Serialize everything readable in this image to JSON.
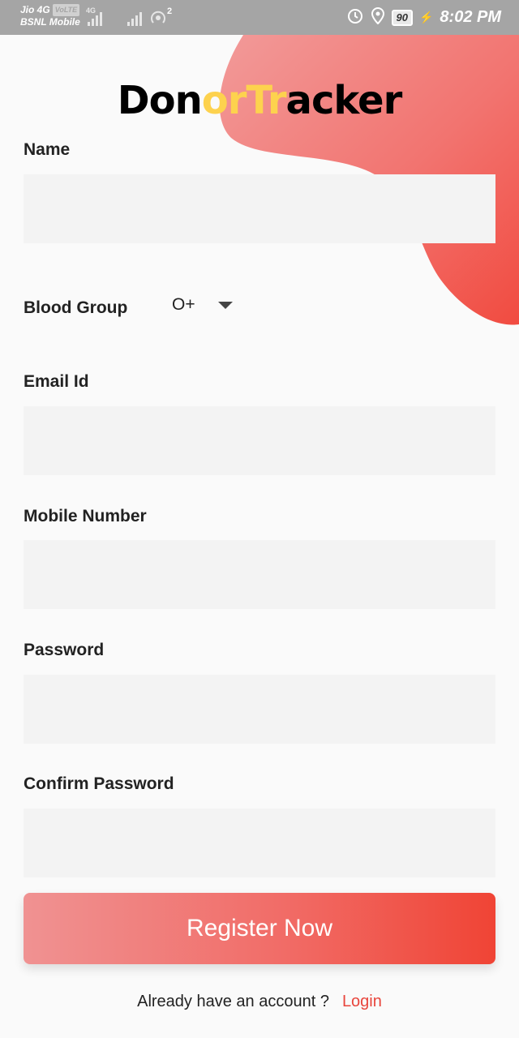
{
  "status_bar": {
    "carrier1": "Jio 4G",
    "volte": "VoLTE",
    "carrier2": "BSNL Mobile",
    "network": "4G",
    "hotspot_count": "2",
    "battery": "90",
    "time": "8:02 PM",
    "icons": [
      "signal-icon",
      "hotspot-icon",
      "alarm-icon",
      "location-icon",
      "battery-icon",
      "charging-icon"
    ]
  },
  "app": {
    "logo_parts": [
      "Don",
      "or",
      "T",
      "r",
      "acker"
    ],
    "accent_color": "#f04435",
    "logo_highlight_color": "#fdd24e"
  },
  "form": {
    "name_label": "Name",
    "name_value": "",
    "blood_group_label": "Blood Group",
    "blood_group_value": "O+",
    "email_label": "Email Id",
    "email_value": "",
    "mobile_label": "Mobile Number",
    "mobile_value": "",
    "password_label": "Password",
    "password_value": "",
    "confirm_label": "Confirm Password",
    "confirm_value": "",
    "submit_label": "Register Now"
  },
  "footer": {
    "prompt": "Already have an account ?",
    "login_label": "Login"
  }
}
